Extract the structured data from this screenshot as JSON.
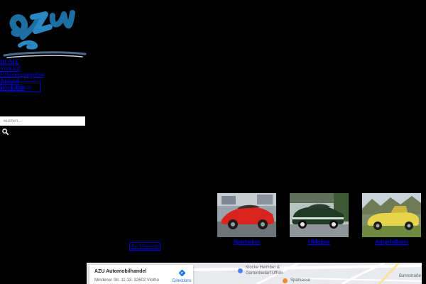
{
  "header": {
    "logo_icon": "azu-logo-icon"
  },
  "nav": {
    "items": [
      {
        "label": "HOME"
      },
      {
        "label": "Verkauf"
      },
      {
        "label": "Fahrzeugangebot"
      },
      {
        "label": "Ankauf"
      },
      {
        "label": "Werkstatt"
      }
    ],
    "box_item": "Kontakt"
  },
  "search": {
    "placeholder": "Suchen...",
    "icon": "search-icon"
  },
  "gallery": {
    "tiles": [
      {
        "label": "Sportautos",
        "icon": "red-sportscar-photo"
      },
      {
        "label": "Oldtimer",
        "icon": "green-classic-car-photo"
      },
      {
        "label": "Ausgefallenes",
        "icon": "yellow-convertible-photo"
      }
    ],
    "overview_label": "Zur Übersicht"
  },
  "map": {
    "business_name": "AZU Automobilhandel",
    "business_address": "Mindener Str. 11-13, 32602 Vlotho",
    "directions_label": "Directions",
    "label_store_1": "Klocke Heimber &",
    "label_store_2": "Gartenbedarf Uffeln",
    "label_bank": "Sparkasse",
    "label_street": "Bahnstraße",
    "colors": {
      "poi_store": "#4285f4",
      "poi_food": "#f28b2a",
      "directions": "#1a73e8"
    }
  }
}
